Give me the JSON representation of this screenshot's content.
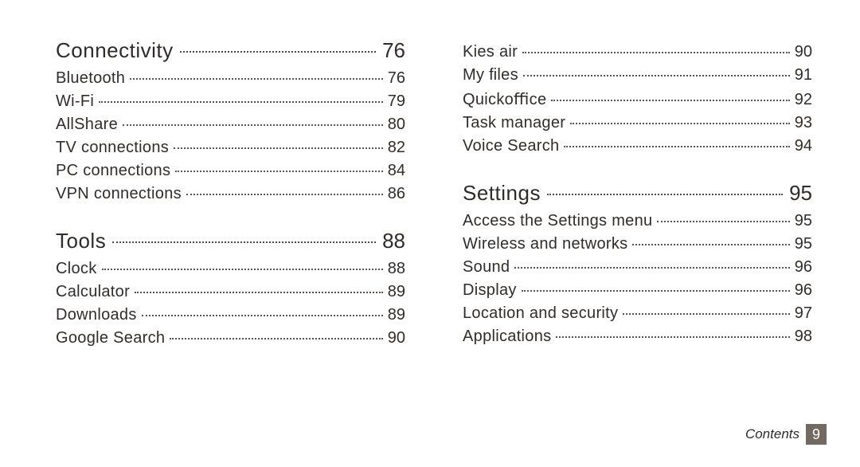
{
  "footer": {
    "label": "Contents",
    "page": "9"
  },
  "columns": [
    {
      "sections": [
        {
          "title": "Connectivity",
          "page": "76",
          "entries": [
            {
              "title": "Bluetooth",
              "page": "76"
            },
            {
              "title": "Wi-Fi",
              "page": "79"
            },
            {
              "title": "AllShare",
              "page": "80"
            },
            {
              "title": "TV connections",
              "page": "82"
            },
            {
              "title": "PC connections",
              "page": "84"
            },
            {
              "title": "VPN connections",
              "page": "86"
            }
          ]
        },
        {
          "title": "Tools",
          "page": "88",
          "entries": [
            {
              "title": "Clock",
              "page": "88"
            },
            {
              "title": "Calculator",
              "page": "89"
            },
            {
              "title": "Downloads",
              "page": "89"
            },
            {
              "title": "Google Search",
              "page": "90"
            }
          ]
        }
      ]
    },
    {
      "sections": [
        {
          "title": null,
          "page": null,
          "entries": [
            {
              "title": "Kies air",
              "page": "90"
            },
            {
              "title": "My ﬁles",
              "page": "91"
            },
            {
              "title": "Quickoﬃce",
              "page": "92"
            },
            {
              "title": "Task manager",
              "page": "93"
            },
            {
              "title": "Voice Search",
              "page": "94"
            }
          ]
        },
        {
          "title": "Settings",
          "page": "95",
          "entries": [
            {
              "title": "Access the Settings menu",
              "page": "95"
            },
            {
              "title": "Wireless and networks",
              "page": "95"
            },
            {
              "title": "Sound",
              "page": "96"
            },
            {
              "title": "Display",
              "page": "96"
            },
            {
              "title": "Location and security",
              "page": "97"
            },
            {
              "title": "Applications",
              "page": "98"
            }
          ]
        }
      ]
    }
  ]
}
